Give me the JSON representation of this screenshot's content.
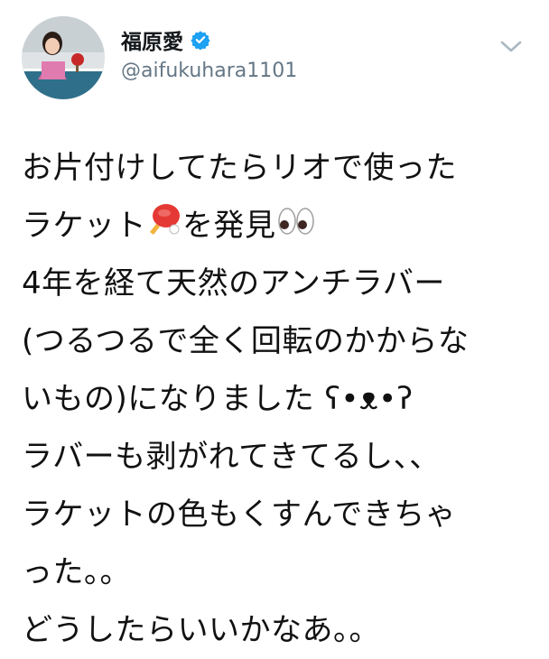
{
  "user": {
    "display_name": "福原愛",
    "handle": "@aifukuhara1101",
    "verified": true
  },
  "icons": {
    "verified": "verified-badge-icon",
    "menu": "chevron-down-icon",
    "emoji_racket": "ping-pong-paddle-emoji",
    "emoji_eyes": "eyes-emoji"
  },
  "colors": {
    "verified_blue": "#1da1f2",
    "handle_gray": "#657786",
    "text": "#14171a"
  },
  "tweet": {
    "line1": "お片付けしてたらリオで使った",
    "line2a": "ラケット",
    "line2b": "を発見",
    "line3": "4年を経て天然のアンチラバー",
    "line4": "(つるつるで全く回転のかからな",
    "line5": "いもの)になりました ʕ•ᴥ•ʔ",
    "line6": "ラバーも剥がれてきてるし、、",
    "line7": "ラケットの色もくすんできちゃ",
    "line8": "った。。",
    "line9": "どうしたらいいかなあ。。"
  }
}
